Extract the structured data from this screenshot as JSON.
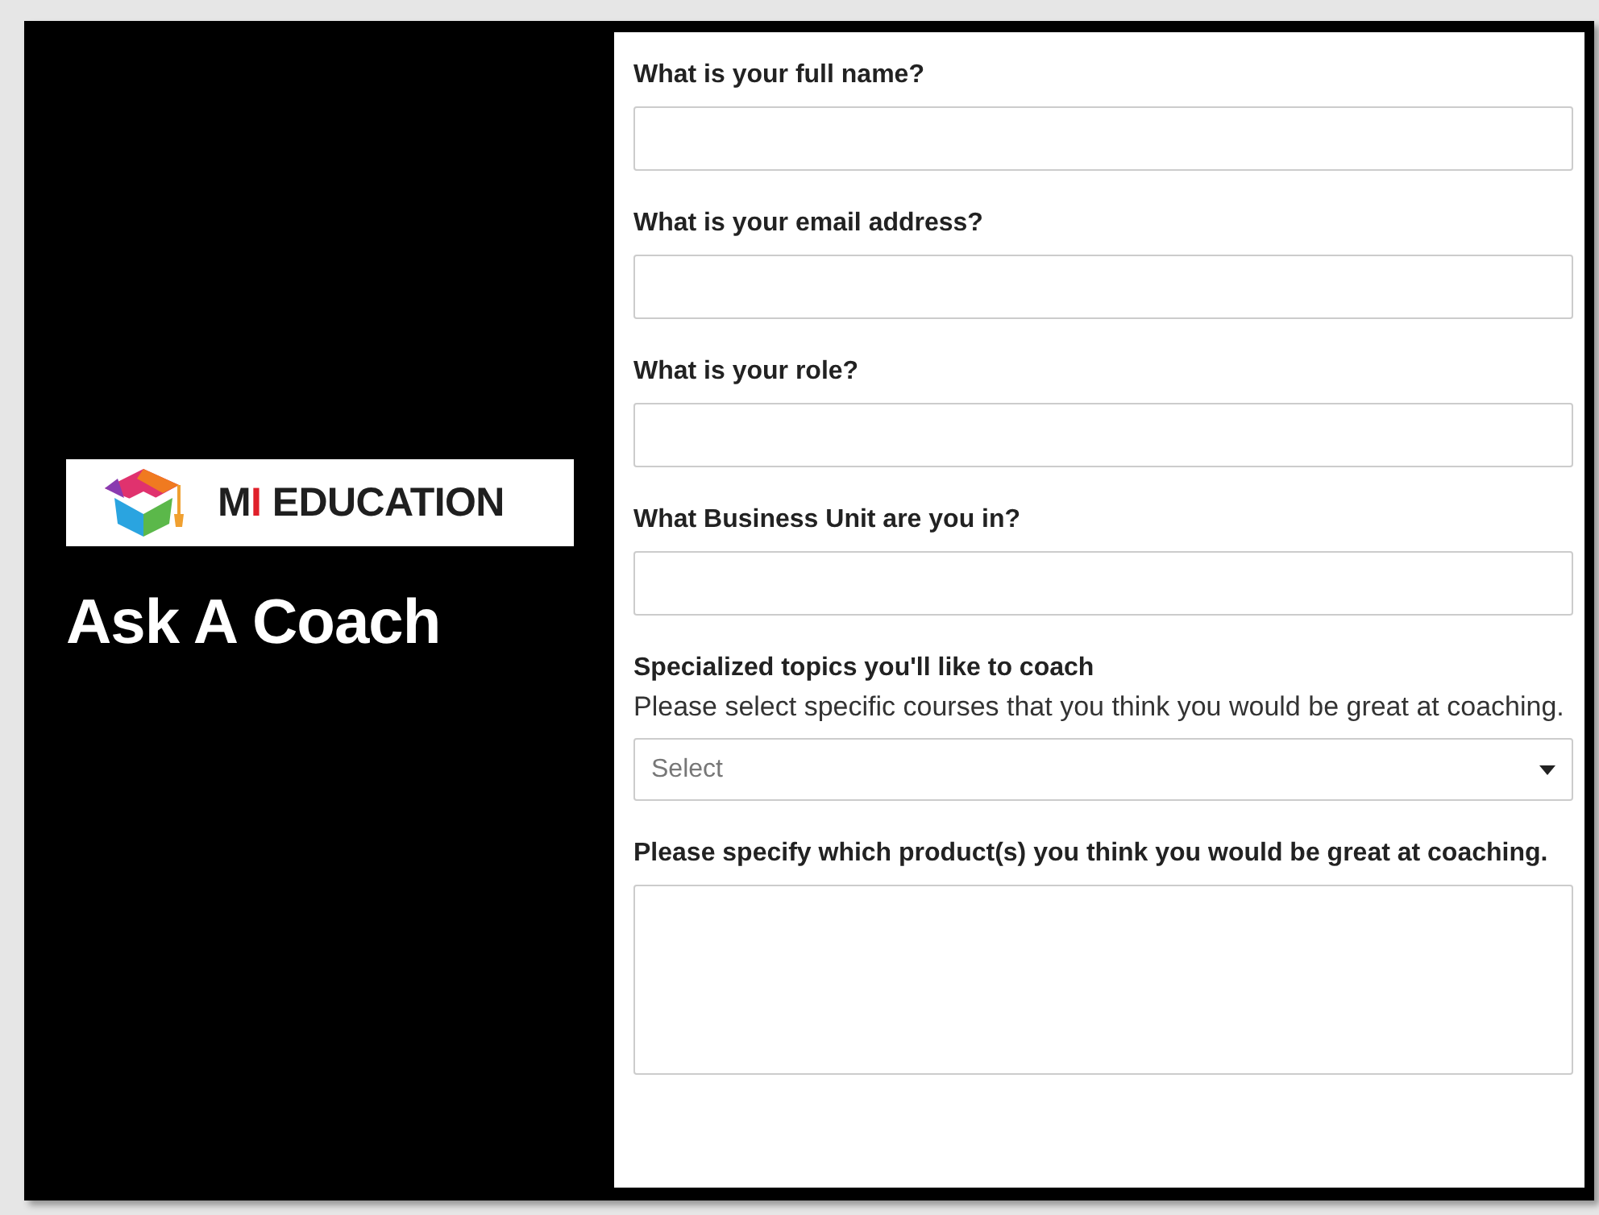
{
  "brand": {
    "logo_parts": [
      {
        "text": "M",
        "color": "#1f1f1f"
      },
      {
        "text": "I",
        "color": "#e0202a"
      },
      {
        "text": " EDUCATION",
        "color": "#1f1f1f"
      }
    ]
  },
  "title": "Ask A Coach",
  "form": {
    "fields": [
      {
        "kind": "text",
        "label": "What is your full name?"
      },
      {
        "kind": "text",
        "label": "What is your email address?"
      },
      {
        "kind": "text",
        "label": "What is your role?"
      },
      {
        "kind": "text",
        "label": "What Business Unit are you in?"
      },
      {
        "kind": "select",
        "label": "Specialized topics you'll like to coach",
        "help": "Please select specific courses that you think you would be great at coaching.",
        "placeholder": "Select"
      },
      {
        "kind": "textarea",
        "label": "Please specify which product(s) you think you would be great at coaching."
      }
    ]
  }
}
